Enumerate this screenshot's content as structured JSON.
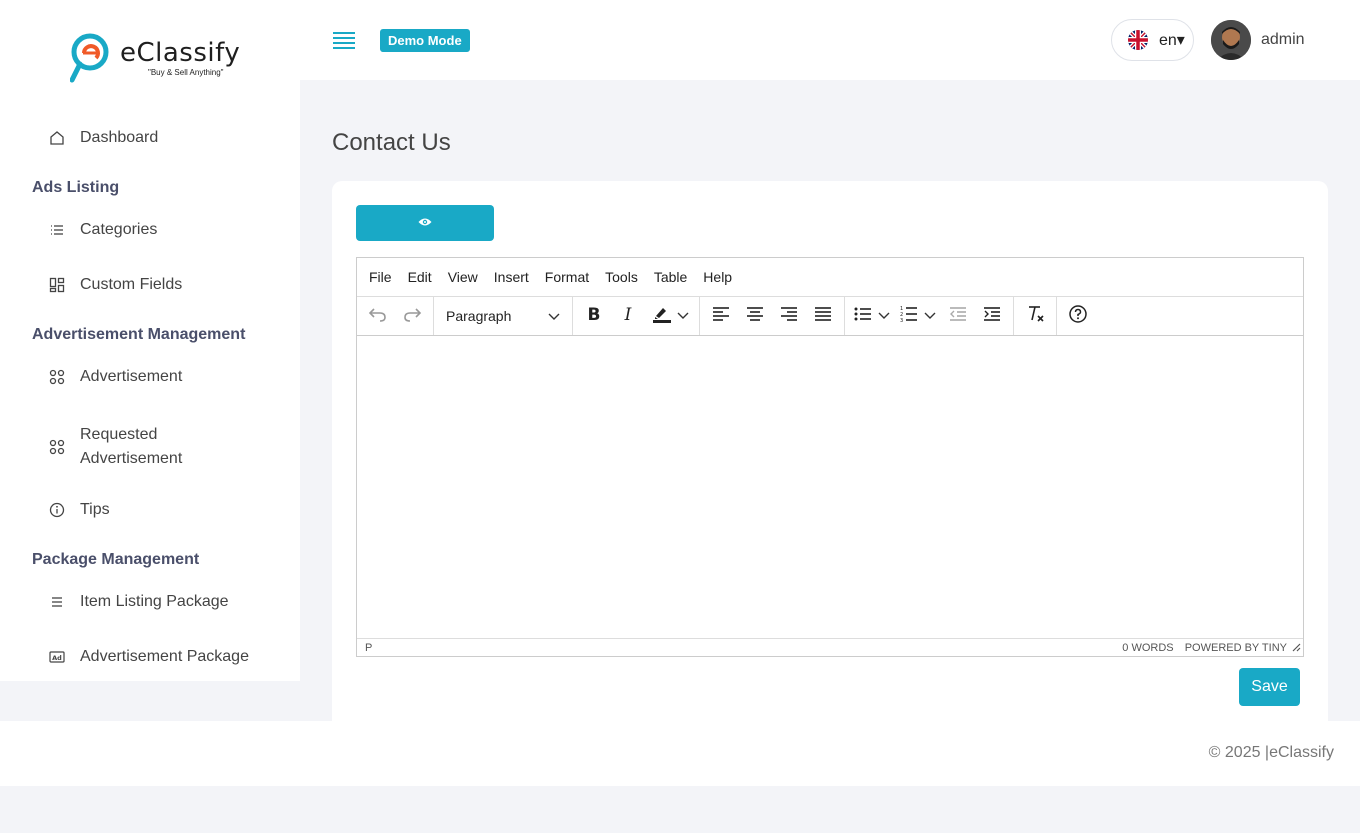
{
  "brand": {
    "name": "eClassify",
    "tagline": "\"Buy & Sell Anything\"",
    "accent": "#19a9c6",
    "logo_orange": "#f05a28"
  },
  "sidebar": {
    "dashboard": "Dashboard",
    "sections": [
      {
        "heading": "Ads Listing",
        "items": [
          "Categories",
          "Custom Fields"
        ]
      },
      {
        "heading": "Advertisement Management",
        "items": [
          "Advertisement",
          "Requested Advertisement",
          "Tips"
        ]
      },
      {
        "heading": "Package Management",
        "items": [
          "Item Listing Package",
          "Advertisement Package"
        ]
      }
    ]
  },
  "header": {
    "demo_badge": "Demo Mode",
    "language": "en▾",
    "user": "admin"
  },
  "main": {
    "title": "Contact Us",
    "editor": {
      "menu": [
        "File",
        "Edit",
        "View",
        "Insert",
        "Format",
        "Tools",
        "Table",
        "Help"
      ],
      "block_format": "Paragraph",
      "status_path": "P",
      "word_count": "0 WORDS",
      "powered_by": "POWERED BY TINY"
    },
    "save_label": "Save"
  },
  "footer": {
    "copyright": "© 2025 |eClassify"
  }
}
